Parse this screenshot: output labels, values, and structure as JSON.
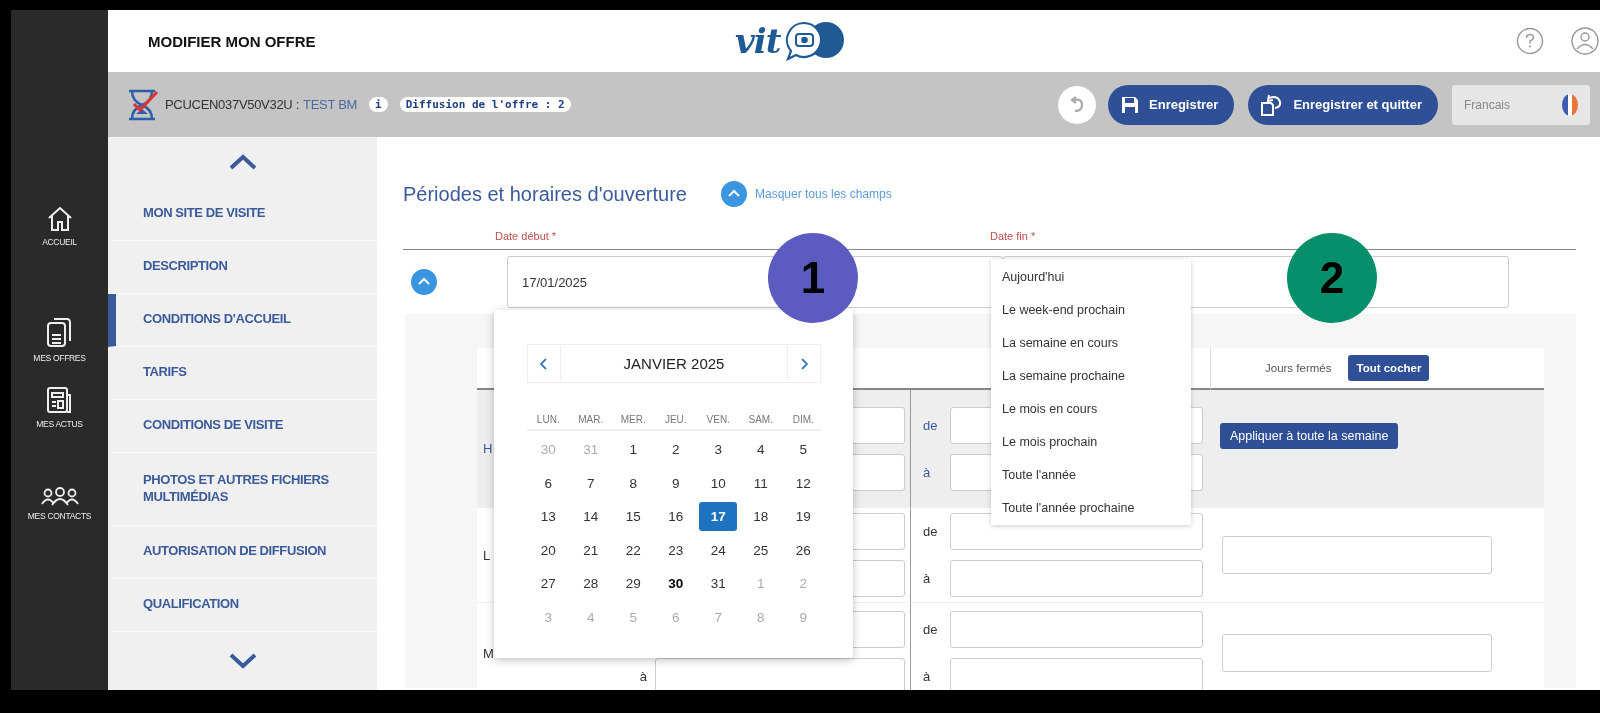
{
  "header": {
    "title": "MODIFIER MON OFFRE",
    "logo": "vit"
  },
  "rail": [
    {
      "label": "ACCUEIL",
      "kind": "home"
    },
    {
      "label": "MES OFFRES",
      "kind": "offers"
    },
    {
      "label": "MES ACTUS",
      "kind": "news"
    },
    {
      "label": "MES CONTACTS",
      "kind": "contacts"
    }
  ],
  "offer_bar": {
    "code": "PCUCEN037V50V32U :",
    "name": "TEST BM",
    "info": "i",
    "diffusion": "Diffusion de l'offre : 2",
    "buttons": [
      {
        "label": "Enregistrer",
        "kind": "save"
      },
      {
        "label": "Enregistrer et quitter",
        "kind": "save-quit"
      }
    ],
    "language": "Francais"
  },
  "menu": {
    "items": [
      {
        "label": "MON SITE DE VISITE",
        "selected": false
      },
      {
        "label": "DESCRIPTION",
        "selected": false
      },
      {
        "label": "CONDITIONS D'ACCUEIL",
        "selected": true
      },
      {
        "label": "TARIFS",
        "selected": false
      },
      {
        "label": "CONDITIONS DE VISITE",
        "selected": false
      },
      {
        "label": "PHOTOS ET AUTRES FICHIERS MULTIMÉDIAS",
        "selected": false
      },
      {
        "label": "AUTORISATION DE DIFFUSION",
        "selected": false
      },
      {
        "label": "QUALIFICATION",
        "selected": false
      }
    ]
  },
  "section": {
    "title": "Périodes et horaires d'ouverture",
    "toggle_all": "Masquer tous les champs",
    "start_label": "Date début *",
    "end_label": "Date fin *",
    "start_value": "17/01/2025"
  },
  "calendar": {
    "month": "JANVIER 2025",
    "weekdays": [
      "LUN.",
      "MAR.",
      "MER.",
      "JEU.",
      "VEN.",
      "SAM.",
      "DIM."
    ],
    "weeks": [
      [
        {
          "label": "30",
          "kind": "other",
          "selected": false
        },
        {
          "label": "31",
          "kind": "other",
          "selected": false
        },
        {
          "label": "1",
          "kind": "current",
          "selected": false
        },
        {
          "label": "2",
          "kind": "current",
          "selected": false
        },
        {
          "label": "3",
          "kind": "current",
          "selected": false
        },
        {
          "label": "4",
          "kind": "current",
          "selected": false
        },
        {
          "label": "5",
          "kind": "current",
          "selected": false
        }
      ],
      [
        {
          "label": "6",
          "kind": "current",
          "selected": false
        },
        {
          "label": "7",
          "kind": "current",
          "selected": false
        },
        {
          "label": "8",
          "kind": "current",
          "selected": false
        },
        {
          "label": "9",
          "kind": "current",
          "selected": false
        },
        {
          "label": "10",
          "kind": "current",
          "selected": false
        },
        {
          "label": "11",
          "kind": "current",
          "selected": false
        },
        {
          "label": "12",
          "kind": "current",
          "selected": false
        }
      ],
      [
        {
          "label": "13",
          "kind": "current",
          "selected": false
        },
        {
          "label": "14",
          "kind": "current",
          "selected": false
        },
        {
          "label": "15",
          "kind": "current",
          "selected": false
        },
        {
          "label": "16",
          "kind": "current",
          "selected": false
        },
        {
          "label": "17",
          "kind": "current",
          "selected": true
        },
        {
          "label": "18",
          "kind": "current",
          "selected": false
        },
        {
          "label": "19",
          "kind": "current",
          "selected": false
        }
      ],
      [
        {
          "label": "20",
          "kind": "current",
          "selected": false
        },
        {
          "label": "21",
          "kind": "current",
          "selected": false
        },
        {
          "label": "22",
          "kind": "current",
          "selected": false
        },
        {
          "label": "23",
          "kind": "current",
          "selected": false
        },
        {
          "label": "24",
          "kind": "current",
          "selected": false
        },
        {
          "label": "25",
          "kind": "current",
          "selected": false
        },
        {
          "label": "26",
          "kind": "current",
          "selected": false
        }
      ],
      [
        {
          "label": "27",
          "kind": "current",
          "selected": false
        },
        {
          "label": "28",
          "kind": "current",
          "selected": false
        },
        {
          "label": "29",
          "kind": "current",
          "selected": false
        },
        {
          "label": "30",
          "kind": "today",
          "selected": false
        },
        {
          "label": "31",
          "kind": "current",
          "selected": false
        },
        {
          "label": "1",
          "kind": "other",
          "selected": false
        },
        {
          "label": "2",
          "kind": "other",
          "selected": false
        }
      ],
      [
        {
          "label": "3",
          "kind": "other",
          "selected": false
        },
        {
          "label": "4",
          "kind": "other",
          "selected": false
        },
        {
          "label": "5",
          "kind": "other",
          "selected": false
        },
        {
          "label": "6",
          "kind": "other",
          "selected": false
        },
        {
          "label": "7",
          "kind": "other",
          "selected": false
        },
        {
          "label": "8",
          "kind": "other",
          "selected": false
        },
        {
          "label": "9",
          "kind": "other",
          "selected": false
        }
      ]
    ]
  },
  "end_presets": [
    "Aujourd'hui",
    "Le week-end prochain",
    "La semaine en cours",
    "La semaine prochaine",
    "Le mois en cours",
    "Le mois prochain",
    "Toute l'année",
    "Toute l'année prochaine"
  ],
  "schedule": {
    "closed_label": "Jours fermés",
    "check_all": "Tout cocher",
    "rows": [
      {
        "kind": "all",
        "day": "H",
        "from_label": "de",
        "to_label": "à",
        "apply": "Appliquer à toute la semaine"
      },
      {
        "kind": "day",
        "day": "L",
        "from_label": "de",
        "to_label": "à"
      },
      {
        "kind": "day",
        "day": "M",
        "from_label": "de",
        "to_label": "à",
        "left_to_label": "à"
      }
    ]
  },
  "badges": [
    {
      "label": "1",
      "color": "#5b5bc0"
    },
    {
      "label": "2",
      "color": "#078f6b"
    }
  ]
}
